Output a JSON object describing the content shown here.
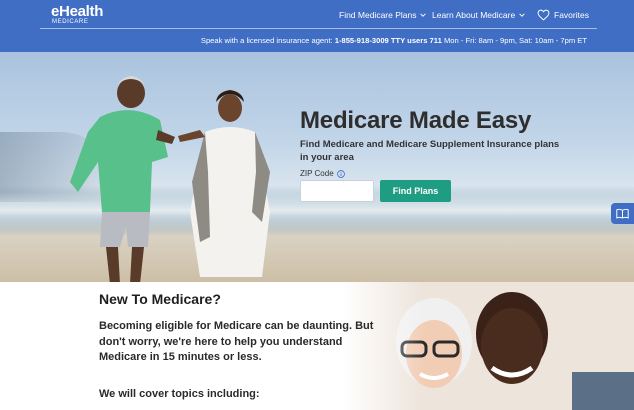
{
  "brand": {
    "name": "eHealth",
    "sub": "MEDICARE"
  },
  "nav": {
    "find_plans": "Find Medicare Plans",
    "learn": "Learn About Medicare",
    "favorites": "Favorites"
  },
  "agent": {
    "prefix": "Speak with a licensed insurance agent:",
    "phone": "1-855-918-3009 TTY users 711",
    "hours": "Mon - Fri: 8am - 9pm, Sat: 10am - 7pm ET"
  },
  "hero": {
    "title": "Medicare Made Easy",
    "subtitle": "Find Medicare and Medicare Supplement Insurance plans in your area",
    "zip_label": "ZIP Code",
    "zip_value": "",
    "button": "Find Plans"
  },
  "intro": {
    "title": "New To Medicare?",
    "body": "Becoming eligible for Medicare can be daunting. But don't worry, we're here to help you understand Medicare in 15 minutes or less.",
    "topics": "We will cover topics including:"
  },
  "colors": {
    "header": "#3f6ec4",
    "button": "#1f9d82"
  },
  "icons": [
    "chevron-down-icon",
    "heart-icon",
    "info-icon",
    "book-icon"
  ]
}
